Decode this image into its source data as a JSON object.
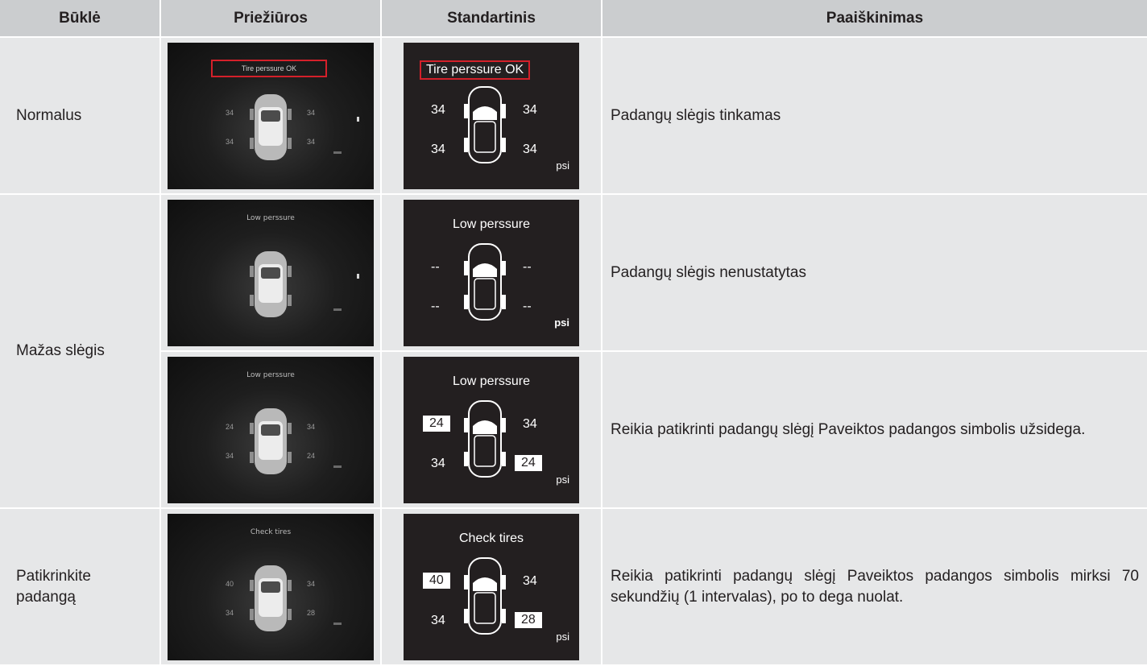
{
  "headers": [
    "Būklė",
    "Priežiūros",
    "Standartinis",
    "Paaiškinimas"
  ],
  "rows": [
    {
      "status": "Normalus",
      "photo_title": "Tire perssure OK",
      "photo_values": [
        "34",
        "34",
        "34",
        "34"
      ],
      "std_title": "Tire perssure OK",
      "std_values": [
        "34",
        "34",
        "34",
        "34"
      ],
      "unit": "psi",
      "description": "Padangų slėgis tinkamas"
    },
    {
      "status": "Mažas slėgis",
      "photo_title": "Low perssure",
      "photo_values": [
        "",
        "",
        "",
        ""
      ],
      "std_title": "Low perssure",
      "std_values": [
        "--",
        "--",
        "--",
        "--"
      ],
      "unit": "psi",
      "description": "Padangų slėgis nenustatytas"
    },
    {
      "status": "",
      "photo_title": "Low perssure",
      "photo_values": [
        "24",
        "34",
        "34",
        "24"
      ],
      "std_title": "Low perssure",
      "std_values": [
        "24",
        "34",
        "34",
        "24"
      ],
      "unit": "psi",
      "description": "Reikia patikrinti padangų slėgį Paveiktos padangos simbolis užsidega."
    },
    {
      "status": "Patikrinkite padangą",
      "photo_title": "Check tires",
      "photo_values": [
        "40",
        "34",
        "34",
        "28"
      ],
      "std_title": "Check tires",
      "std_values": [
        "40",
        "34",
        "34",
        "28"
      ],
      "unit": "psi",
      "description": "Reikia patikrinti padangų slėgį Paveiktos padangos simbolis mirksi 70 sekundžių (1 intervalas), po to dega nuolat."
    }
  ]
}
